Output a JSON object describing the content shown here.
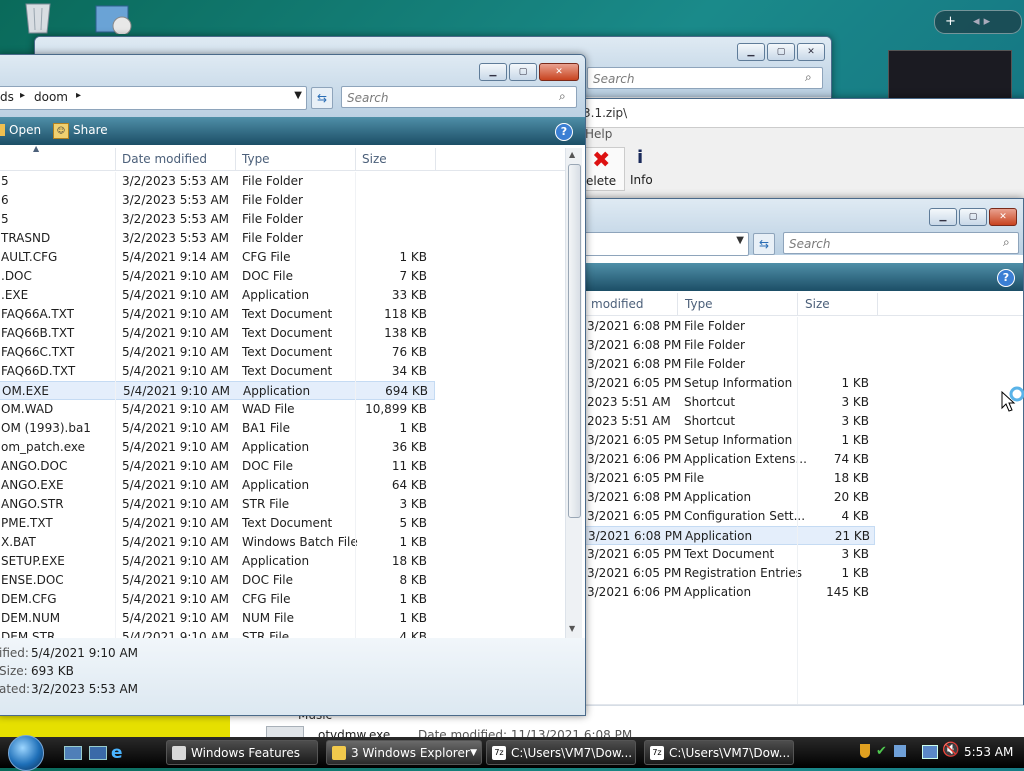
{
  "desktop": {
    "recycle_bin_icon": "recycle-bin",
    "setup_icon": "installer"
  },
  "gadget": {
    "plus": "+",
    "arrows": "◂ ▸"
  },
  "win_back": {
    "search_placeholder": "Search"
  },
  "win_zip": {
    "path": "3.1.zip\\",
    "menu_help": "Help",
    "delete_label": "elete",
    "info_label": "Info"
  },
  "win_right": {
    "search_placeholder": "Search",
    "columns": {
      "date": "modified",
      "type": "Type",
      "size": "Size"
    },
    "rows": [
      {
        "date": "3/2021 6:08 PM",
        "type": "File Folder",
        "size": ""
      },
      {
        "date": "3/2021 6:08 PM",
        "type": "File Folder",
        "size": ""
      },
      {
        "date": "3/2021 6:08 PM",
        "type": "File Folder",
        "size": ""
      },
      {
        "date": "3/2021 6:05 PM",
        "type": "Setup Information",
        "size": "1 KB"
      },
      {
        "date": "2023 5:51 AM",
        "type": "Shortcut",
        "size": "3 KB"
      },
      {
        "date": "2023 5:51 AM",
        "type": "Shortcut",
        "size": "3 KB"
      },
      {
        "date": "3/2021 6:05 PM",
        "type": "Setup Information",
        "size": "1 KB"
      },
      {
        "date": "3/2021 6:06 PM",
        "type": "Application Extens...",
        "size": "74 KB"
      },
      {
        "date": "3/2021 6:05 PM",
        "type": "File",
        "size": "18 KB"
      },
      {
        "date": "3/2021 6:08 PM",
        "type": "Application",
        "size": "20 KB"
      },
      {
        "date": "3/2021 6:05 PM",
        "type": "Configuration Sett...",
        "size": "4 KB"
      },
      {
        "date": "3/2021 6:08 PM",
        "type": "Application",
        "size": "21 KB"
      },
      {
        "date": "3/2021 6:05 PM",
        "type": "Text Document",
        "size": "3 KB"
      },
      {
        "date": "3/2021 6:05 PM",
        "type": "Registration Entries",
        "size": "1 KB"
      },
      {
        "date": "3/2021 6:06 PM",
        "type": "Application",
        "size": "145 KB"
      }
    ],
    "selected_index": 11,
    "bottom_folder": "Music",
    "bottom_file": "otvdmw.exe",
    "bottom_date": "Date modified: 11/13/2021 6:08 PM"
  },
  "win_main": {
    "breadcrumb_prev": "ds",
    "breadcrumb_current": "doom",
    "search_placeholder": "Search",
    "cmd_open": "Open",
    "cmd_share": "Share",
    "help": "?",
    "columns": {
      "name": "",
      "date": "Date modified",
      "type": "Type",
      "size": "Size"
    },
    "rows": [
      {
        "name": "5",
        "date": "3/2/2023 5:53 AM",
        "type": "File Folder",
        "size": ""
      },
      {
        "name": "6",
        "date": "3/2/2023 5:53 AM",
        "type": "File Folder",
        "size": ""
      },
      {
        "name": "5",
        "date": "3/2/2023 5:53 AM",
        "type": "File Folder",
        "size": ""
      },
      {
        "name": "TRASND",
        "date": "3/2/2023 5:53 AM",
        "type": "File Folder",
        "size": ""
      },
      {
        "name": "AULT.CFG",
        "date": "5/4/2021 9:14 AM",
        "type": "CFG File",
        "size": "1 KB"
      },
      {
        "name": ".DOC",
        "date": "5/4/2021 9:10 AM",
        "type": "DOC File",
        "size": "7 KB"
      },
      {
        "name": ".EXE",
        "date": "5/4/2021 9:10 AM",
        "type": "Application",
        "size": "33 KB"
      },
      {
        "name": "FAQ66A.TXT",
        "date": "5/4/2021 9:10 AM",
        "type": "Text Document",
        "size": "118 KB"
      },
      {
        "name": "FAQ66B.TXT",
        "date": "5/4/2021 9:10 AM",
        "type": "Text Document",
        "size": "138 KB"
      },
      {
        "name": "FAQ66C.TXT",
        "date": "5/4/2021 9:10 AM",
        "type": "Text Document",
        "size": "76 KB"
      },
      {
        "name": "FAQ66D.TXT",
        "date": "5/4/2021 9:10 AM",
        "type": "Text Document",
        "size": "34 KB"
      },
      {
        "name": "OM.EXE",
        "date": "5/4/2021 9:10 AM",
        "type": "Application",
        "size": "694 KB"
      },
      {
        "name": "OM.WAD",
        "date": "5/4/2021 9:10 AM",
        "type": "WAD File",
        "size": "10,899 KB"
      },
      {
        "name": "OM (1993).ba1",
        "date": "5/4/2021 9:10 AM",
        "type": "BA1 File",
        "size": "1 KB"
      },
      {
        "name": "om_patch.exe",
        "date": "5/4/2021 9:10 AM",
        "type": "Application",
        "size": "36 KB"
      },
      {
        "name": "ANGO.DOC",
        "date": "5/4/2021 9:10 AM",
        "type": "DOC File",
        "size": "11 KB"
      },
      {
        "name": "ANGO.EXE",
        "date": "5/4/2021 9:10 AM",
        "type": "Application",
        "size": "64 KB"
      },
      {
        "name": "ANGO.STR",
        "date": "5/4/2021 9:10 AM",
        "type": "STR File",
        "size": "3 KB"
      },
      {
        "name": "PME.TXT",
        "date": "5/4/2021 9:10 AM",
        "type": "Text Document",
        "size": "5 KB"
      },
      {
        "name": "X.BAT",
        "date": "5/4/2021 9:10 AM",
        "type": "Windows Batch File",
        "size": "1 KB"
      },
      {
        "name": "SETUP.EXE",
        "date": "5/4/2021 9:10 AM",
        "type": "Application",
        "size": "18 KB"
      },
      {
        "name": "ENSE.DOC",
        "date": "5/4/2021 9:10 AM",
        "type": "DOC File",
        "size": "8 KB"
      },
      {
        "name": "DEM.CFG",
        "date": "5/4/2021 9:10 AM",
        "type": "CFG File",
        "size": "1 KB"
      },
      {
        "name": "DEM.NUM",
        "date": "5/4/2021 9:10 AM",
        "type": "NUM File",
        "size": "1 KB"
      },
      {
        "name": "DEM.STR",
        "date": "5/4/2021 9:10 AM",
        "type": "STR File",
        "size": "4 KB"
      }
    ],
    "selected_index": 11,
    "details": {
      "modified_label": "ified:",
      "modified_value": "5/4/2021 9:10 AM",
      "size_label": "Size:",
      "size_value": "693 KB",
      "created_label": "ated:",
      "created_value": "3/2/2023 5:53 AM"
    }
  },
  "taskbar": {
    "items": [
      {
        "label": "Windows Features"
      },
      {
        "label": "3 Windows Explorer"
      },
      {
        "label": "C:\\Users\\VM7\\Dow..."
      },
      {
        "label": "C:\\Users\\VM7\\Dow..."
      }
    ],
    "clock": "5:53 AM"
  },
  "colors": {
    "accent": "#1c4e66",
    "selection": "#e4eefb",
    "close": "#c8431f"
  }
}
